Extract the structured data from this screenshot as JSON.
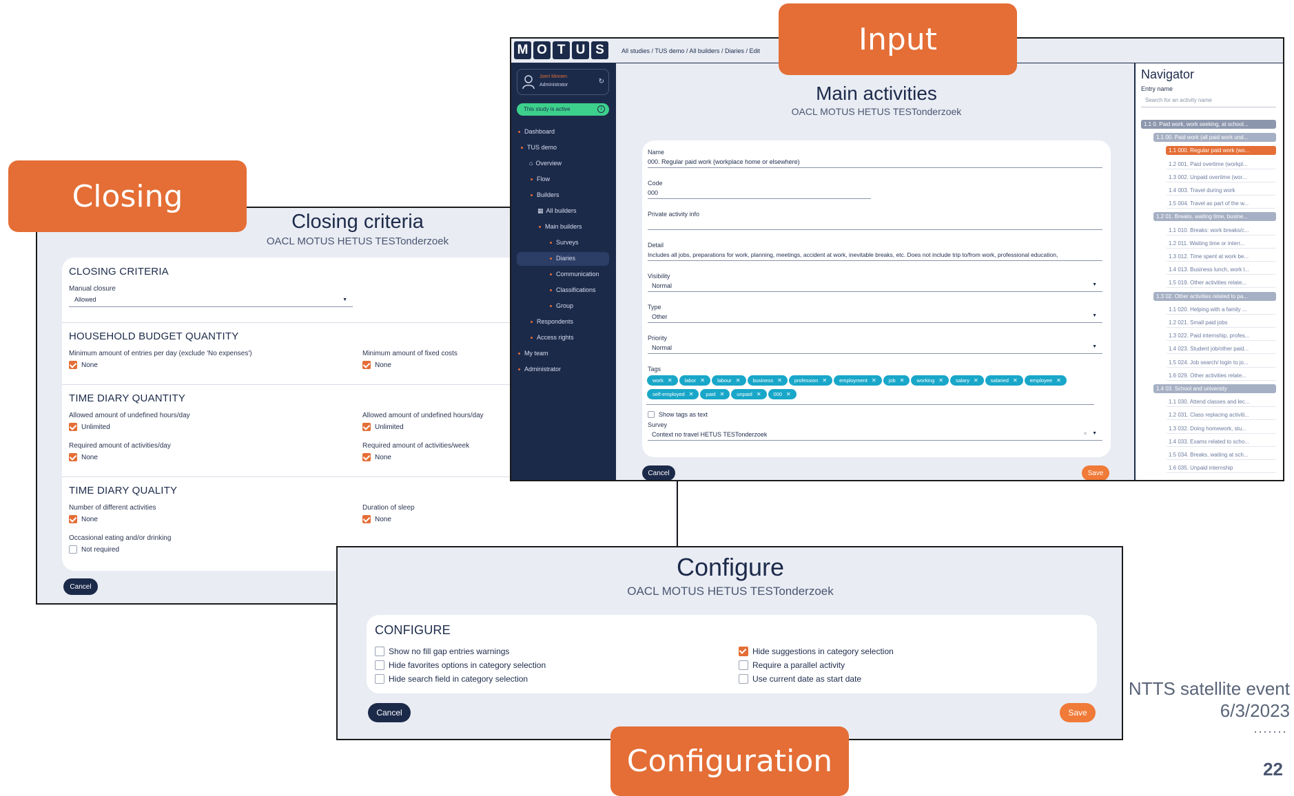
{
  "labels": {
    "closing": "Closing",
    "input": "Input",
    "configuration": "Configuration"
  },
  "footer": {
    "event": "NTTS satellite event",
    "date": "6/3/2023",
    "page": "22",
    "dots": "·······"
  },
  "closing": {
    "title": "Closing criteria",
    "subtitle": "OACL MOTUS HETUS TESTonderzoek",
    "sections": {
      "criteria": {
        "heading": "CLOSING CRITERIA",
        "manual_label": "Manual closure",
        "manual_value": "Allowed"
      },
      "budget": {
        "heading": "HOUSEHOLD BUDGET QUANTITY",
        "left_label": "Minimum amount of entries per day (exclude 'No expenses')",
        "left_value": "None",
        "right_label": "Minimum amount of fixed costs",
        "right_value": "None"
      },
      "diary_quantity": {
        "heading": "TIME DIARY QUANTITY",
        "a_label": "Allowed amount of undefined hours/day",
        "a_value": "Unlimited",
        "b_label": "Allowed amount of undefined hours/day",
        "b_value": "Unlimited",
        "c_label": "Required amount of activities/day",
        "c_value": "None",
        "d_label": "Required amount of activities/week",
        "d_value": "None"
      },
      "diary_quality": {
        "heading": "TIME DIARY QUALITY",
        "a_label": "Number of different activities",
        "a_value": "None",
        "b_label": "Duration of sleep",
        "b_value": "None",
        "c_label": "Occasional eating and/or drinking",
        "c_value": "Not required"
      }
    },
    "cancel": "Cancel"
  },
  "input": {
    "logo_letters": [
      "M",
      "O",
      "T",
      "U",
      "S"
    ],
    "breadcrumb": [
      "All studies",
      "TUS demo",
      "All builders",
      "Diaries",
      "Edit"
    ],
    "user_name": "Joeri Minnen",
    "user_role": "Administrator",
    "study_status": "This study is active",
    "sidebar": {
      "dashboard": "Dashboard",
      "tus_demo": "TUS demo",
      "overview": "Overview",
      "flow": "Flow",
      "builders": "Builders",
      "all_builders": "All builders",
      "main_builders": "Main builders",
      "surveys": "Surveys",
      "diaries": "Diaries",
      "communication": "Communication",
      "classifications": "Classifications",
      "group": "Group",
      "respondents": "Respondents",
      "access_rights": "Access rights",
      "my_team": "My team",
      "administrator": "Administrator"
    },
    "title": "Main activities",
    "subtitle": "OACL MOTUS HETUS TESTonderzoek",
    "form": {
      "name_label": "Name",
      "name_value": "000. Regular paid work (workplace home or elsewhere)",
      "code_label": "Code",
      "code_value": "000",
      "private_label": "Private activity info",
      "detail_label": "Detail",
      "detail_value": "Includes all jobs, preparations for work, planning, meetings, accident at work, inevitable breaks, etc. Does not include trip to/from work, professional education,",
      "visibility_label": "Visibility",
      "visibility_value": "Normal",
      "type_label": "Type",
      "type_value": "Other",
      "priority_label": "Priority",
      "priority_value": "Normal",
      "tags_label": "Tags",
      "tags": [
        "work",
        "labor",
        "labour",
        "business",
        "profession",
        "employment",
        "job",
        "working",
        "salary",
        "salaried",
        "employee",
        "self-employed",
        "paid",
        "unpaid",
        "000"
      ],
      "show_tags_text": "Show tags as text",
      "survey_label": "Survey",
      "survey_value": "Context no travel HETUS TESTonderzoek"
    },
    "cancel": "Cancel",
    "save": "Save",
    "navigator": {
      "title": "Navigator",
      "entry_label": "Entry name",
      "search_placeholder": "Search for an activity name",
      "items": [
        {
          "text": "1.1 0. Paid work, work seeking, at school...",
          "level": 1
        },
        {
          "text": "1.1 00. Paid work (all paid work und...",
          "level": 2
        },
        {
          "text": "1.1 000. Regular paid work (wo...",
          "level": 3,
          "active": true
        },
        {
          "text": "1.2 001. Paid overtime (workpl...",
          "level": 3
        },
        {
          "text": "1.3 002. Unpaid overtime (wor...",
          "level": 3
        },
        {
          "text": "1.4 003. Travel during work",
          "level": 3
        },
        {
          "text": "1.5 004. Travel as part of the w...",
          "level": 3
        },
        {
          "text": "1.2 01. Breaks, waiting time, busine...",
          "level": 2
        },
        {
          "text": "1.1 010. Breaks: work breaks/c...",
          "level": 3
        },
        {
          "text": "1.2 011. Waiting time or interr...",
          "level": 3
        },
        {
          "text": "1.3 012. Time spent at work be...",
          "level": 3
        },
        {
          "text": "1.4 013. Business lunch, work l...",
          "level": 3
        },
        {
          "text": "1.5 019. Other activities relate...",
          "level": 3
        },
        {
          "text": "1.3 02. Other activities related to pa...",
          "level": 2
        },
        {
          "text": "1.1 020. Helping with a family ...",
          "level": 3
        },
        {
          "text": "1.2 021. Small paid jobs",
          "level": 3
        },
        {
          "text": "1.3 022. Paid internship, profes...",
          "level": 3
        },
        {
          "text": "1.4 023. Student job/other paid...",
          "level": 3
        },
        {
          "text": "1.5 024. Job search/ login to jo...",
          "level": 3
        },
        {
          "text": "1.6 029. Other activities relate...",
          "level": 3
        },
        {
          "text": "1.4 03. School and university",
          "level": 2
        },
        {
          "text": "1.1 030. Attend classes and lec...",
          "level": 3
        },
        {
          "text": "1.2 031. Class replacing activiti...",
          "level": 3
        },
        {
          "text": "1.3 032. Doing homework, stu...",
          "level": 3
        },
        {
          "text": "1.4 033. Exams related to scho...",
          "level": 3
        },
        {
          "text": "1.5 034. Breaks, waiting at sch...",
          "level": 3
        },
        {
          "text": "1.6 035. Unpaid internship",
          "level": 3
        }
      ]
    }
  },
  "configure": {
    "title": "Configure",
    "subtitle": "OACL MOTUS HETUS TESTonderzoek",
    "heading": "CONFIGURE",
    "left": [
      {
        "label": "Show no fill gap entries warnings",
        "checked": false
      },
      {
        "label": "Hide favorites options in category selection",
        "checked": false
      },
      {
        "label": "Hide search field in category selection",
        "checked": false
      }
    ],
    "right": [
      {
        "label": "Hide suggestions in category selection",
        "checked": true
      },
      {
        "label": "Require a parallel activity",
        "checked": false
      },
      {
        "label": "Use current date as start date",
        "checked": false
      }
    ],
    "cancel": "Cancel",
    "save": "Save"
  },
  "colors": {
    "accent": "#e46e36",
    "navy": "#1c2a4a",
    "tag": "#19a7c9",
    "status": "#3dd08c"
  }
}
